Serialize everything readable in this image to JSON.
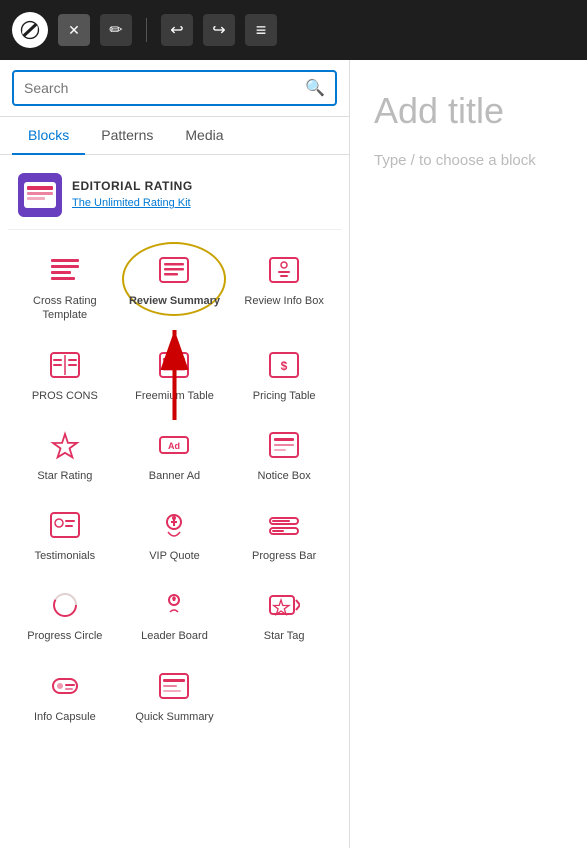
{
  "toolbar": {
    "wp_logo_alt": "WordPress Logo",
    "close_btn": "✕",
    "pen_btn": "✏",
    "undo_btn": "↩",
    "redo_btn": "↪",
    "menu_btn": "≡"
  },
  "search": {
    "placeholder": "Search",
    "icon": "🔍"
  },
  "tabs": [
    {
      "label": "Blocks",
      "active": true
    },
    {
      "label": "Patterns",
      "active": false
    },
    {
      "label": "Media",
      "active": false
    }
  ],
  "editorial": {
    "title": "EDITORIAL RATING",
    "subtitle": "The Unlimited Rating Kit"
  },
  "blocks": [
    {
      "id": "cross-rating-template",
      "label": "Cross Rating Template",
      "icon": "list-icon"
    },
    {
      "id": "review-summary",
      "label": "Review Summary",
      "icon": "review-icon",
      "highlighted": true
    },
    {
      "id": "review-info-box",
      "label": "Review Info Box",
      "icon": "info-icon"
    },
    {
      "id": "pros-cons",
      "label": "PROS CONS",
      "icon": "pros-cons-icon"
    },
    {
      "id": "freemium-table",
      "label": "Freemium Table",
      "icon": "freemium-icon"
    },
    {
      "id": "pricing-table",
      "label": "Pricing Table",
      "icon": "pricing-icon"
    },
    {
      "id": "star-rating",
      "label": "Star Rating",
      "icon": "star-icon"
    },
    {
      "id": "banner-ad",
      "label": "Banner Ad",
      "icon": "banner-icon"
    },
    {
      "id": "notice-box",
      "label": "Notice Box",
      "icon": "notice-icon"
    },
    {
      "id": "testimonials",
      "label": "Testimonials",
      "icon": "testimonials-icon"
    },
    {
      "id": "vip-quote",
      "label": "VIP Quote",
      "icon": "vip-icon"
    },
    {
      "id": "progress-bar",
      "label": "Progress Bar",
      "icon": "progress-bar-icon"
    },
    {
      "id": "progress-circle",
      "label": "Progress Circle",
      "icon": "progress-circle-icon"
    },
    {
      "id": "leader-board",
      "label": "Leader Board",
      "icon": "leader-board-icon"
    },
    {
      "id": "star-tag",
      "label": "Star Tag",
      "icon": "star-tag-icon"
    },
    {
      "id": "info-capsule",
      "label": "Info Capsule",
      "icon": "info-capsule-icon"
    },
    {
      "id": "quick-summary",
      "label": "Quick Summary",
      "icon": "quick-summary-icon"
    }
  ],
  "right_panel": {
    "title": "Add title",
    "hint": "Type / to choose a block"
  }
}
